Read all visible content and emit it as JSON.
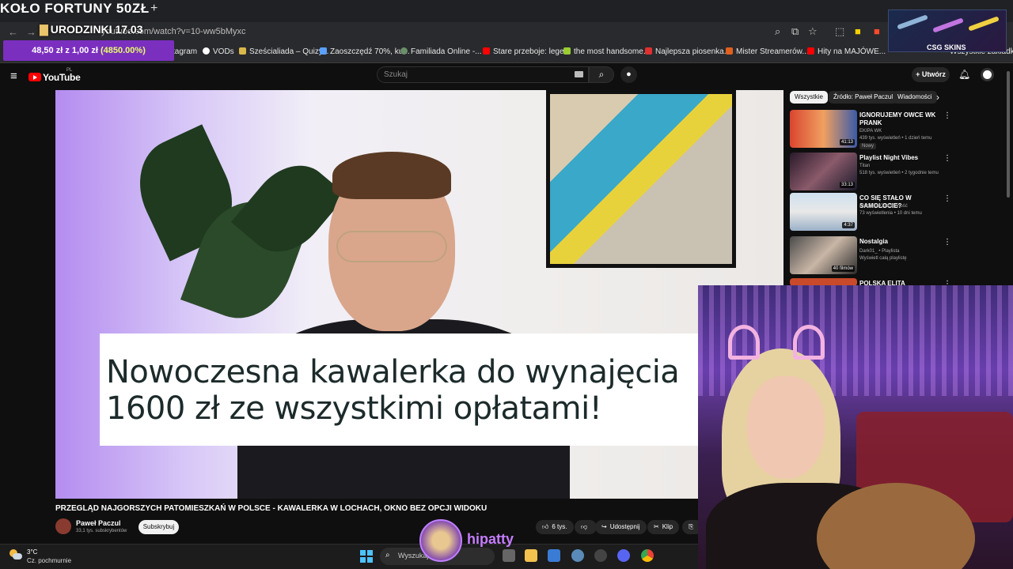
{
  "stream": {
    "tab_title": "KOŁO FORTUNY 50ZŁ",
    "tab_plus": "+",
    "birthday": "URODZINKI 17.03",
    "goal_prefix": "48,50 zł z 1,00 zł ",
    "goal_pct": "(4850.00%)",
    "sponsor": "CSG SKINS",
    "streamer": "hipatty"
  },
  "browser": {
    "url": "youtube.com/watch?v=10-ww5bMyxc",
    "bookmarks": [
      {
        "label": "tagram",
        "color": "#292a2d"
      },
      {
        "label": "VODs",
        "color": "#ffffff"
      },
      {
        "label": "Sześcialiada – Quizy...",
        "color": "#d9b74a"
      },
      {
        "label": "Zaoszczędź 70%, ku...",
        "color": "#5aa0ff"
      },
      {
        "label": "Familiada Online -...",
        "color": "#6a8f6a"
      },
      {
        "label": "Stare przeboje: lege...",
        "color": "#ff0000"
      },
      {
        "label": "the most handsome...",
        "color": "#9acd32"
      },
      {
        "label": "Najlepsza piosenka...",
        "color": "#e03030"
      },
      {
        "label": "Mister Streamerów...",
        "color": "#e06020"
      },
      {
        "label": "Hity na MAJÓWE...",
        "color": "#ff0000"
      },
      {
        "label": "Wszystkie zakładki",
        "color": "#777777"
      }
    ]
  },
  "youtube": {
    "logo": "YouTube",
    "region": "PL",
    "search_placeholder": "Szukaj",
    "create": "Utwórz",
    "video": {
      "caption_line1": "Nowoczesna kawalerka do wynajęcia",
      "caption_line2": "1600 zł ze wszystkimi opłatami!",
      "title": "PRZEGLĄD NAJGORSZYCH PATOMIESZKAŃ W POLSCE - KAWALERKA W LOCHACH, OKNO BEZ OPCJI WIDOKU",
      "channel": "Paweł Paczul",
      "subscribers": "33,1 tys. subskrybentów",
      "subscribe": "Subskrybuj",
      "likes": "6 tys.",
      "share": "Udostępnij",
      "clip": "Klip"
    },
    "chips": [
      "Wszystkie",
      "Źródło: Paweł Paczul",
      "Wiadomości"
    ],
    "recommendations": [
      {
        "title": "IGNORUJEMY OWCE WK PRANK",
        "channel": "EKIPA WK",
        "meta": "439 tys. wyświetleń • 1 dzień temu",
        "duration": "41:13",
        "badge": "Nowy"
      },
      {
        "title": "Playlist Night Vibes",
        "channel": "Titan",
        "meta": "518 tys. wyświetleń • 2 tygodnie temu",
        "duration": "33:13"
      },
      {
        "title": "CO SIĘ STAŁO W SAMOLOCIE?",
        "channel": "Katolicka Codzienność",
        "meta": "73 wyświetlenia • 10 dni temu",
        "duration": "4:37"
      },
      {
        "title": "Nostalgia",
        "channel": "Dark01_ • Playlista",
        "meta": "Wyświetl całą playlistę",
        "duration": "40 filmów"
      },
      {
        "title": "POLSKA ELITA",
        "channel": "",
        "meta": "",
        "duration": ""
      }
    ]
  },
  "taskbar": {
    "temp": "3°C",
    "weather": "Cz. pochmurnie",
    "search": "Wyszukaj"
  }
}
